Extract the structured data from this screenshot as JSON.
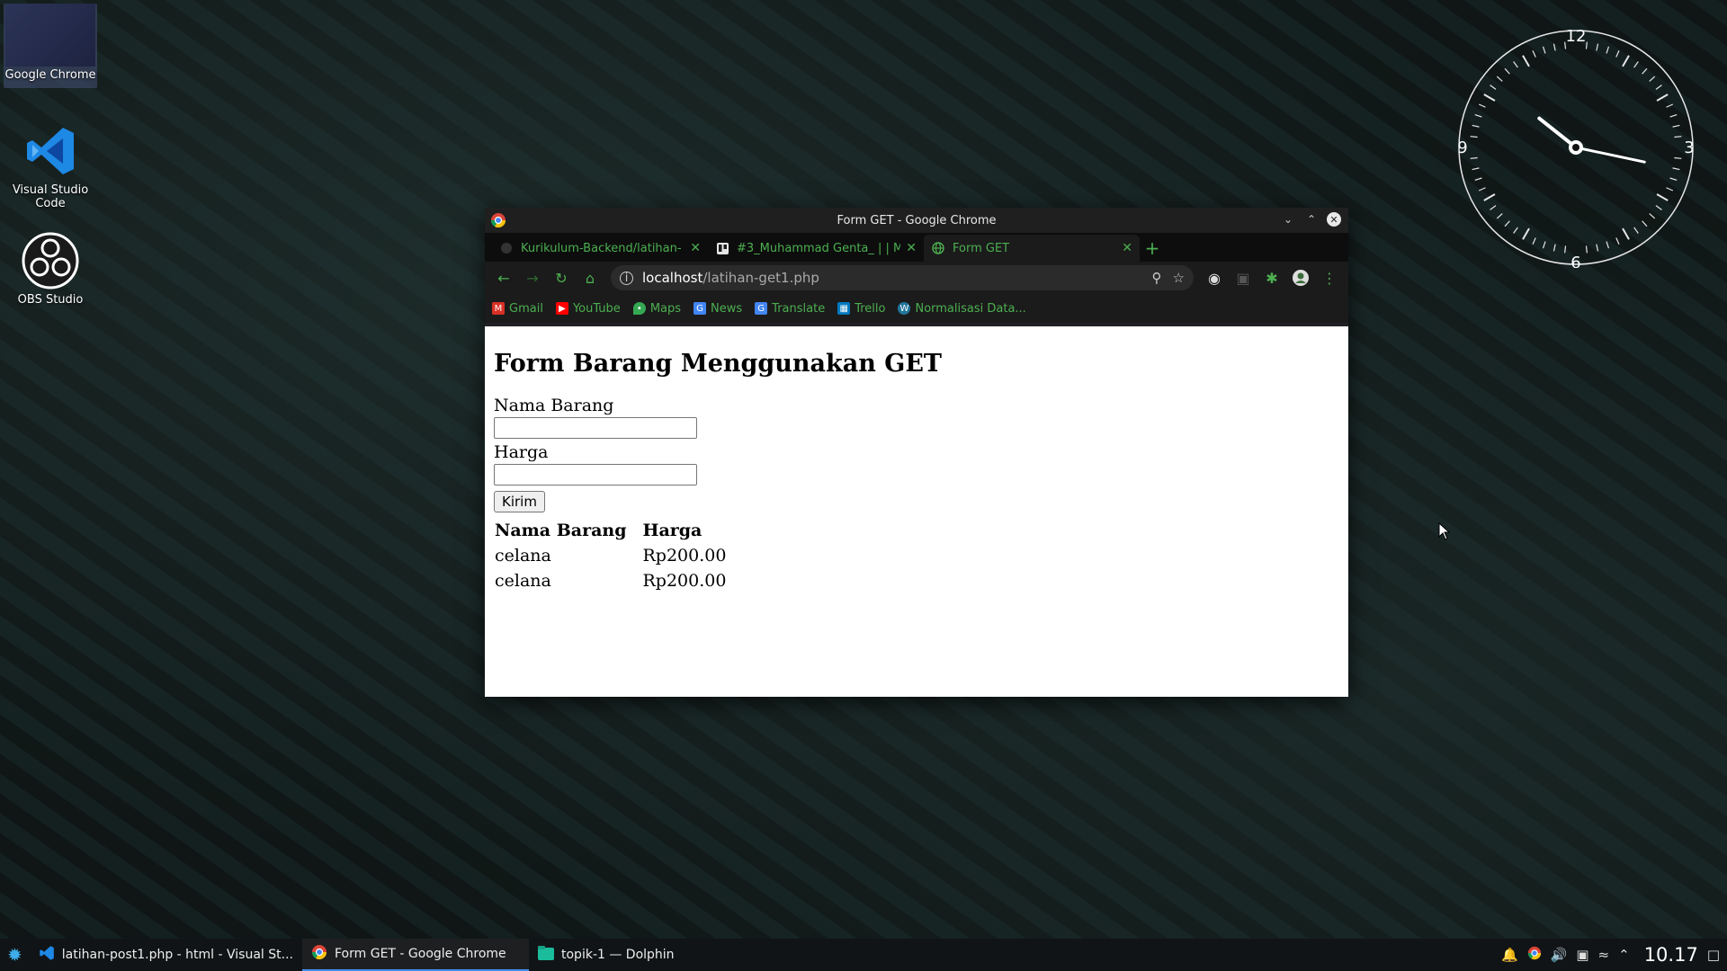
{
  "desktop": {
    "icons": [
      {
        "label": "Google Chrome"
      },
      {
        "label": "Visual Studio Code"
      },
      {
        "label": "OBS Studio"
      }
    ],
    "clock": {
      "numerals": [
        "12",
        "3",
        "6",
        "9"
      ],
      "hour": 10,
      "minute": 17
    }
  },
  "window": {
    "title": "Form GET - Google Chrome",
    "tabs": [
      {
        "label": "Kurikulum-Backend/latihan-",
        "icon": "github-icon"
      },
      {
        "label": "#3_Muhammad Genta_ | | M",
        "icon": "trello-icon"
      },
      {
        "label": "Form GET",
        "icon": "globe-icon"
      }
    ],
    "url": {
      "host": "localhost",
      "path": "/latihan-get1.php"
    },
    "bookmarks": [
      {
        "label": "Gmail",
        "color": "#d93025"
      },
      {
        "label": "YouTube",
        "color": "#ff0000"
      },
      {
        "label": "Maps",
        "color": "#34a853"
      },
      {
        "label": "News",
        "color": "#4285f4"
      },
      {
        "label": "Translate",
        "color": "#4285f4"
      },
      {
        "label": "Trello",
        "color": "#0079bf"
      },
      {
        "label": "Normalisasi Data...",
        "color": "#21759b"
      }
    ],
    "accent": "#4caf50"
  },
  "page": {
    "heading": "Form Barang Menggunakan GET",
    "nama_label": "Nama Barang",
    "nama_value": "",
    "harga_label": "Harga",
    "harga_value": "",
    "submit_label": "Kirim",
    "table": {
      "headers": [
        "Nama Barang",
        "Harga"
      ],
      "rows": [
        [
          "celana",
          "Rp200.00"
        ],
        [
          "celana",
          "Rp200.00"
        ]
      ]
    }
  },
  "taskbar": {
    "tasks": [
      {
        "label": "latihan-post1.php - html - Visual St..."
      },
      {
        "label": "Form GET - Google Chrome"
      },
      {
        "label": "topik-1 — Dolphin"
      }
    ],
    "time": "10.17"
  }
}
